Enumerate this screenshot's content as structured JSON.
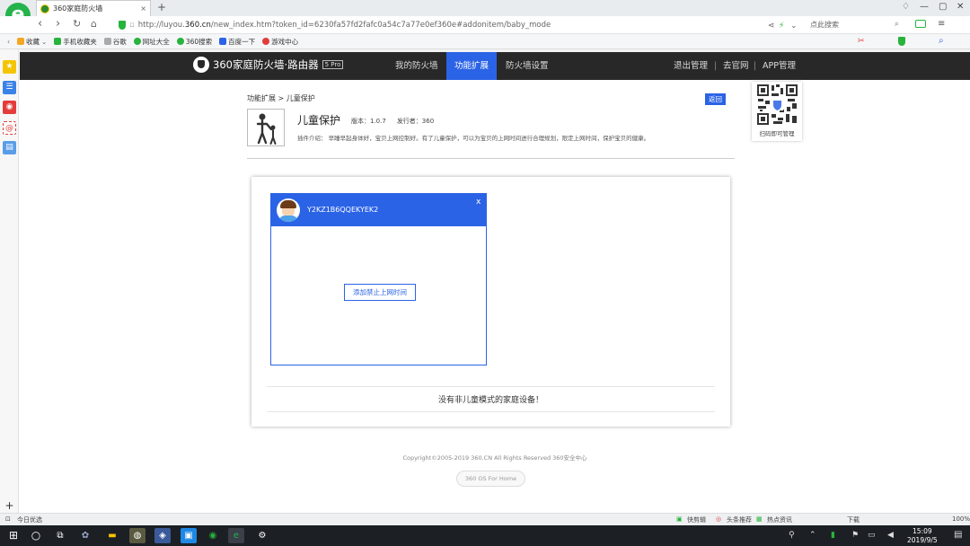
{
  "browser": {
    "tab_title": "360家庭防火墙",
    "tab_close": "×",
    "new_tab": "+",
    "url_prefix": "http://luyou.",
    "url_domain": "360.cn",
    "url_rest": "/new_index.htm?token_id=6230fa57fd2fafc0a54c7a77e0ef360e#addonitem/baby_mode",
    "search_placeholder": "点此搜索",
    "bookmarks": [
      {
        "label": "收藏",
        "color": "#f5a623"
      },
      {
        "label": "手机收藏夹",
        "color": "#27b33c"
      },
      {
        "label": "谷歌",
        "color": "#aaaaaa"
      },
      {
        "label": "网址大全",
        "color": "#27b33c"
      },
      {
        "label": "360搜索",
        "color": "#27b33c"
      },
      {
        "label": "百度一下",
        "color": "#2b63e6"
      },
      {
        "label": "游戏中心",
        "color": "#e33c3c"
      }
    ]
  },
  "router": {
    "brand": "360家庭防火墙·路由器",
    "brand_badge": "5 Pro",
    "nav": {
      "my_firewall": "我的防火墙",
      "extensions": "功能扩展",
      "settings": "防火墙设置",
      "logout": "退出管理",
      "website": "去官网",
      "app": "APP管理",
      "sep": "|"
    },
    "breadcrumb": "功能扩展 > 儿童保护",
    "back": "返回",
    "plugin": {
      "name": "儿童保护",
      "version": "版本：1.0.7",
      "publisher": "发行者：360",
      "description": "插件介绍：  早睡早起身体好，宝贝上网控制好。有了儿童保护，可以为宝贝的上网时间进行合理规划，限定上网时间，保护宝贝的健康。"
    },
    "qr_caption": "扫码即可管理",
    "device": {
      "name": "Y2KZ1B6QQEKYEK2",
      "close": "x",
      "add_button": "添加禁止上网时间"
    },
    "empty_message": "没有非儿童模式的家庭设备！",
    "copyright": "Copyright©2005-2019 360.CN All Rights Reserved 360安全中心",
    "os_button": "360 OS For Home"
  },
  "status": {
    "left": "今日优选",
    "quick": "快剪辑",
    "headline": "头条推荐",
    "hot": "热点资讯",
    "download": "下载",
    "zoom": "100%"
  },
  "taskbar": {
    "time": "15:09",
    "date": "2019/9/5"
  }
}
